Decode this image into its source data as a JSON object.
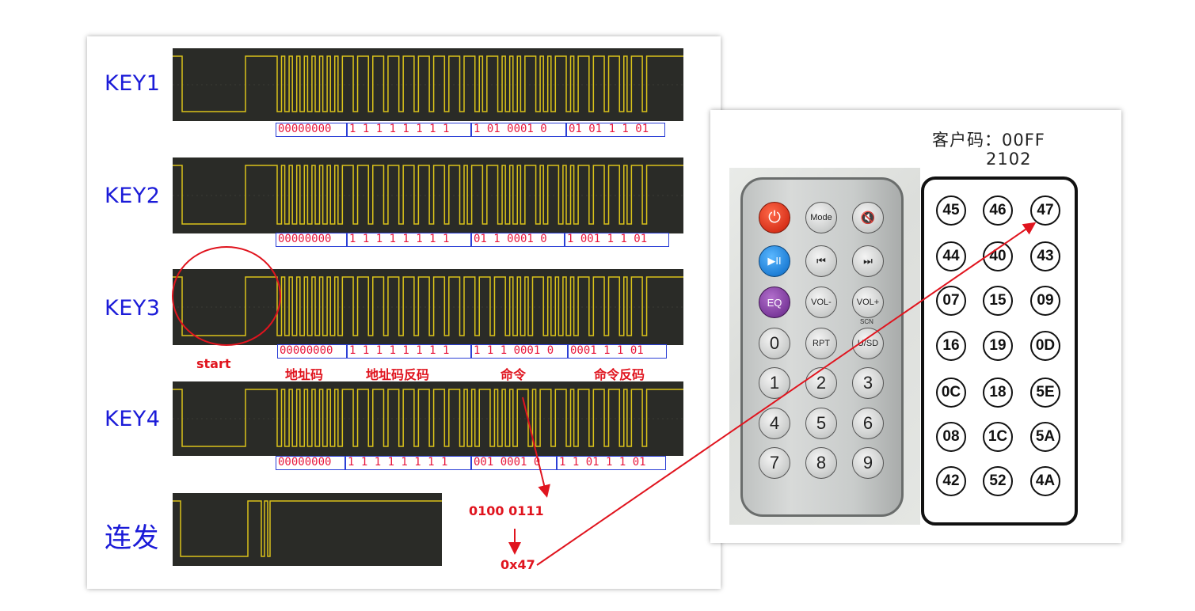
{
  "left": {
    "rows": [
      {
        "label": "KEY1",
        "segments": [
          "00000000",
          "1 1 1 1 1 1 1 1",
          "1 01 0001 0",
          "01 01 1 1 01"
        ]
      },
      {
        "label": "KEY2",
        "segments": [
          "00000000",
          "1 1 1 1 1 1 1 1",
          "01 1 0001 0",
          "1 001 1 1 01"
        ]
      },
      {
        "label": "KEY3",
        "segments": [
          "00000000",
          "1 1 1 1 1 1 1 1",
          "1 1 1 0001 0",
          "0001 1 1 01"
        ]
      },
      {
        "label": "KEY4",
        "segments": [
          "00000000",
          "1 1 1 1 1 1 1 1",
          "001 0001 0",
          "1 1 01 1 1 01"
        ]
      }
    ],
    "repeat_label": "连发",
    "annotations": {
      "start": "start",
      "address": "地址码",
      "address_inverse": "地址码反码",
      "command": "命令",
      "command_inverse": "命令反码",
      "binary": "0100 0111",
      "hex": "0x47"
    }
  },
  "right": {
    "customer_code": "客户码：00FF",
    "model": "2102",
    "remote_buttons": {
      "power": "⏻",
      "mode": "Mode",
      "mute": "🔇",
      "play_pause": "▶II",
      "prev": "⏮",
      "next": "⏭",
      "eq": "EQ",
      "vol_minus": "VOL-",
      "vol_plus": "VOL+",
      "zero": "0",
      "rpt": "RPT",
      "usd": "U/SD",
      "scn": "SCN",
      "numbers": [
        "1",
        "2",
        "3",
        "4",
        "5",
        "6",
        "7",
        "8",
        "9"
      ]
    },
    "codes": [
      "45",
      "46",
      "47",
      "44",
      "40",
      "43",
      "07",
      "15",
      "09",
      "16",
      "19",
      "0D",
      "0C",
      "18",
      "5E",
      "08",
      "1C",
      "5A",
      "42",
      "52",
      "4A"
    ]
  },
  "colors": {
    "accent_red": "#e0141e",
    "box_blue": "#2b3fd6",
    "label_blue": "#1b1bd8",
    "scope_bg": "#2a2b27",
    "trace": "#d9c21a"
  }
}
